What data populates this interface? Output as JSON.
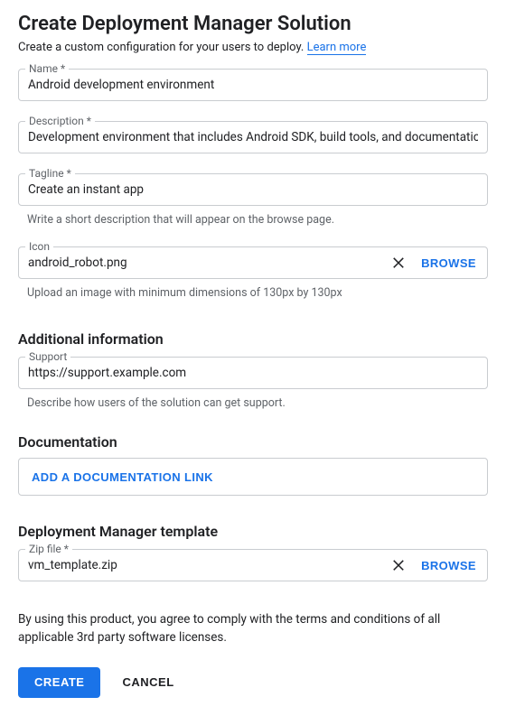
{
  "header": {
    "title": "Create Deployment Manager Solution",
    "subtitle_prefix": "Create a custom configuration for your users to deploy. ",
    "learn_more": "Learn more"
  },
  "fields": {
    "name": {
      "label": "Name *",
      "value": "Android development environment"
    },
    "description": {
      "label": "Description *",
      "value": "Development environment that includes Android SDK, build tools, and documentation."
    },
    "tagline": {
      "label": "Tagline *",
      "value": "Create an instant app",
      "helper": "Write a short description that will appear on the browse page."
    },
    "icon": {
      "label": "Icon",
      "value": "android_robot.png",
      "browse": "BROWSE",
      "helper": "Upload an image with minimum dimensions of 130px by 130px"
    }
  },
  "additional_info": {
    "heading": "Additional information",
    "support": {
      "label": "Support",
      "value": "https://support.example.com",
      "helper": "Describe how users of the solution can get support."
    }
  },
  "documentation": {
    "heading": "Documentation",
    "add_link_label": "ADD A DOCUMENTATION LINK"
  },
  "template": {
    "heading": "Deployment Manager template",
    "zip": {
      "label": "Zip file *",
      "value": "vm_template.zip",
      "browse": "BROWSE"
    }
  },
  "terms_text": "By using this product, you agree to comply with the terms and conditions of all applicable 3rd party software licenses.",
  "actions": {
    "create": "CREATE",
    "cancel": "CANCEL"
  }
}
